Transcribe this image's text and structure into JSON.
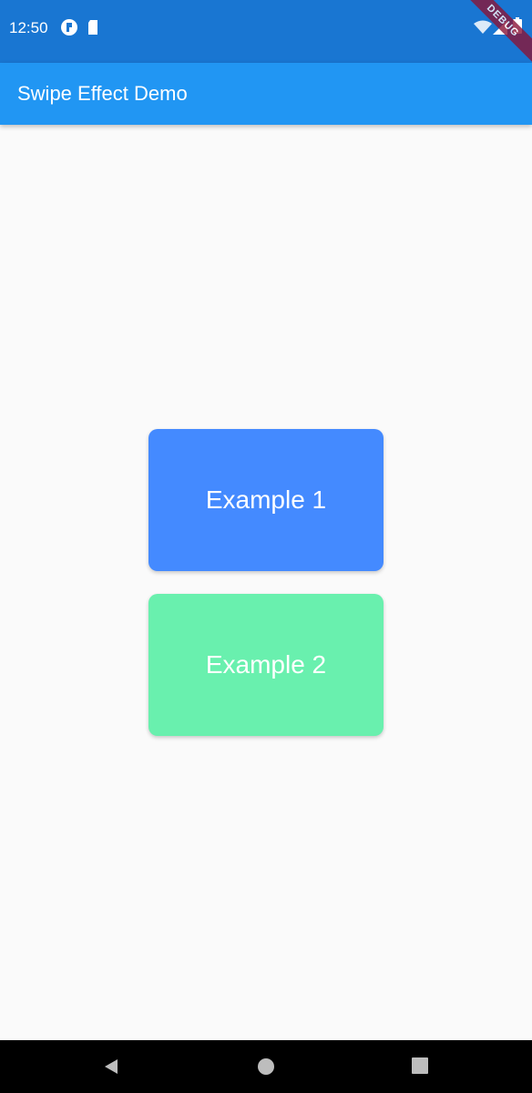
{
  "status_bar": {
    "time": "12:50",
    "icons": [
      "notification-app-icon",
      "sd-card-icon",
      "wifi-icon",
      "signal-icon",
      "battery-icon"
    ],
    "color": "#1976d2"
  },
  "app_bar": {
    "title": "Swipe Effect Demo",
    "color": "#2196f3"
  },
  "debug_banner": {
    "label": "DEBUG"
  },
  "cards": [
    {
      "label": "Example 1",
      "color": "#448aff"
    },
    {
      "label": "Example 2",
      "color": "#69f0ae"
    }
  ],
  "nav_bar": {
    "buttons": [
      "back-icon",
      "home-icon",
      "recents-icon"
    ]
  }
}
